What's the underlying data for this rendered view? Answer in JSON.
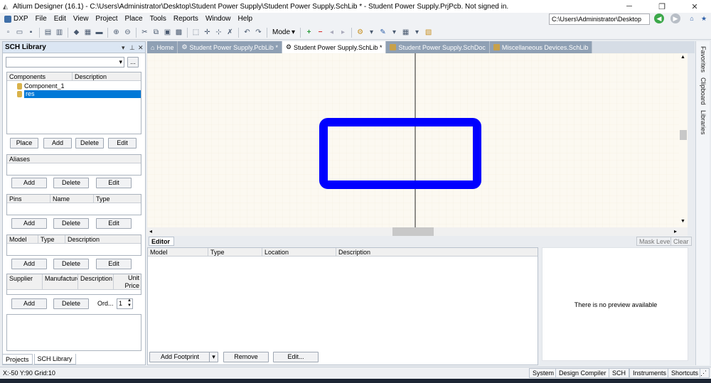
{
  "window": {
    "title": "Altium Designer (16.1) - C:\\Users\\Administrator\\Desktop\\Student Power Supply\\Student Power Supply.SchLib * - Student Power Supply.PrjPcb. Not signed in.",
    "path_box": "C:\\Users\\Administrator\\Desktop"
  },
  "menu": {
    "dxp": "DXP",
    "items": [
      "File",
      "Edit",
      "View",
      "Project",
      "Place",
      "Tools",
      "Reports",
      "Window",
      "Help"
    ]
  },
  "toolbar": {
    "mode_label": "Mode"
  },
  "left_panel": {
    "title": "SCH Library",
    "browse_label": "...",
    "components": {
      "headers": [
        "Components",
        "Description"
      ],
      "items": [
        "Component_1",
        "res"
      ],
      "selected": "res",
      "buttons": [
        "Place",
        "Add",
        "Delete",
        "Edit"
      ]
    },
    "aliases": {
      "header": "Aliases",
      "buttons": [
        "Add",
        "Delete",
        "Edit"
      ]
    },
    "pins": {
      "headers": [
        "Pins",
        "Name",
        "Type"
      ],
      "buttons": [
        "Add",
        "Delete",
        "Edit"
      ]
    },
    "model": {
      "headers": [
        "Model",
        "Type",
        "Description"
      ],
      "buttons": [
        "Add",
        "Delete",
        "Edit"
      ]
    },
    "supplier": {
      "headers": [
        "Supplier",
        "Manufacturer",
        "Description",
        "Unit Price"
      ],
      "buttons": [
        "Add",
        "Delete"
      ],
      "order_label": "Ord...",
      "order_value": "1"
    },
    "tabs": [
      "Projects",
      "SCH Library"
    ]
  },
  "doc_tabs": [
    {
      "label": "Home",
      "active": false
    },
    {
      "label": "Student Power Supply.PcbLib *",
      "active": false
    },
    {
      "label": "Student Power Supply.SchLib *",
      "active": true
    },
    {
      "label": "Student Power Supply.SchDoc",
      "active": false
    },
    {
      "label": "Miscellaneous Devices.SchLib",
      "active": false
    }
  ],
  "editor": {
    "label": "Editor",
    "mask_level": "Mask Level",
    "clear": "Clear",
    "headers": [
      "Model",
      "Type",
      "Location",
      "Description"
    ],
    "buttons": {
      "add_footprint": "Add Footprint",
      "remove": "Remove",
      "edit": "Edit..."
    },
    "preview_text": "There is no preview available"
  },
  "right_tabs": [
    "Favorites",
    "Clipboard",
    "Libraries"
  ],
  "status": {
    "coords": "X:-50 Y:90   Grid:10",
    "buttons": [
      "System",
      "Design Compiler",
      "SCH",
      "Instruments",
      "Shortcuts"
    ]
  },
  "colors": {
    "component_stroke": "#0000ff",
    "canvas_bg": "#fcf9f1",
    "selection": "#0078d7"
  }
}
